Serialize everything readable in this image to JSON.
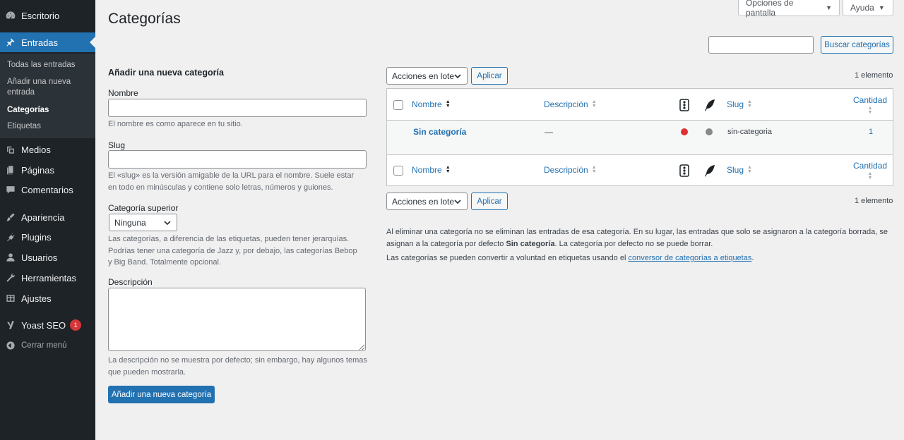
{
  "sidebar": {
    "items": [
      {
        "label": "Escritorio",
        "icon": "dashboard-icon"
      },
      {
        "label": "Entradas",
        "icon": "pin-icon"
      },
      {
        "label": "Medios",
        "icon": "media-icon"
      },
      {
        "label": "Páginas",
        "icon": "pages-icon"
      },
      {
        "label": "Comentarios",
        "icon": "comments-icon"
      },
      {
        "label": "Apariencia",
        "icon": "appearance-icon"
      },
      {
        "label": "Plugins",
        "icon": "plugins-icon"
      },
      {
        "label": "Usuarios",
        "icon": "users-icon"
      },
      {
        "label": "Herramientas",
        "icon": "tools-icon"
      },
      {
        "label": "Ajustes",
        "icon": "settings-icon"
      },
      {
        "label": "Yoast SEO",
        "icon": "yoast-icon",
        "badge": "1"
      }
    ],
    "submenu": [
      "Todas las entradas",
      "Añadir una nueva entrada",
      "Categorías",
      "Etiquetas"
    ],
    "collapse": "Cerrar menú"
  },
  "header": {
    "title": "Categorías",
    "screen_options": "Opciones de pantalla",
    "help": "Ayuda"
  },
  "search": {
    "value": "",
    "button": "Buscar categorías"
  },
  "form": {
    "heading": "Añadir una nueva categoría",
    "name_label": "Nombre",
    "name_help": "El nombre es como aparece en tu sitio.",
    "slug_label": "Slug",
    "slug_help": "El «slug» es la versión amigable de la URL para el nombre. Suele estar en todo en minúsculas y contiene solo letras, números y guiones.",
    "parent_label": "Categoría superior",
    "parent_value": "Ninguna",
    "parent_help": "Las categorías, a diferencia de las etiquetas, pueden tener jerarquías. Podrías tener una categoría de Jazz y, por debajo, las categorías Bebop y Big Band. Totalmente opcional.",
    "desc_label": "Descripción",
    "desc_help": "La descripción no se muestra por defecto; sin embargo, hay algunos temas que pueden mostrarla.",
    "submit": "Añadir una nueva categoría"
  },
  "bulk": {
    "action": "Acciones en lote",
    "apply": "Aplicar",
    "count": "1 elemento"
  },
  "table": {
    "columns": {
      "name": "Nombre",
      "description": "Descripción",
      "slug": "Slug",
      "count": "Cantidad"
    },
    "rows": [
      {
        "name": "Sin categoría",
        "description": "—",
        "slug": "sin-categoria",
        "count": "1",
        "status_color": "#dc3232",
        "status2_color": "#888888"
      }
    ]
  },
  "notes": {
    "p1_a": "Al eliminar una categoría no se eliminan las entradas de esa categoría. En su lugar, las entradas que solo se asignaron a la categoría borrada, se asignan a la categoría por defecto ",
    "p1_b": "Sin categoría",
    "p1_c": ". La categoría por defecto no se puede borrar.",
    "p2_a": "Las categorías se pueden convertir a voluntad en etiquetas usando el ",
    "p2_link": "conversor de categorías a etiquetas",
    "p2_c": "."
  },
  "colors": {
    "accent": "#2271b1",
    "sidebar": "#1d2327",
    "badge": "#d63638"
  }
}
